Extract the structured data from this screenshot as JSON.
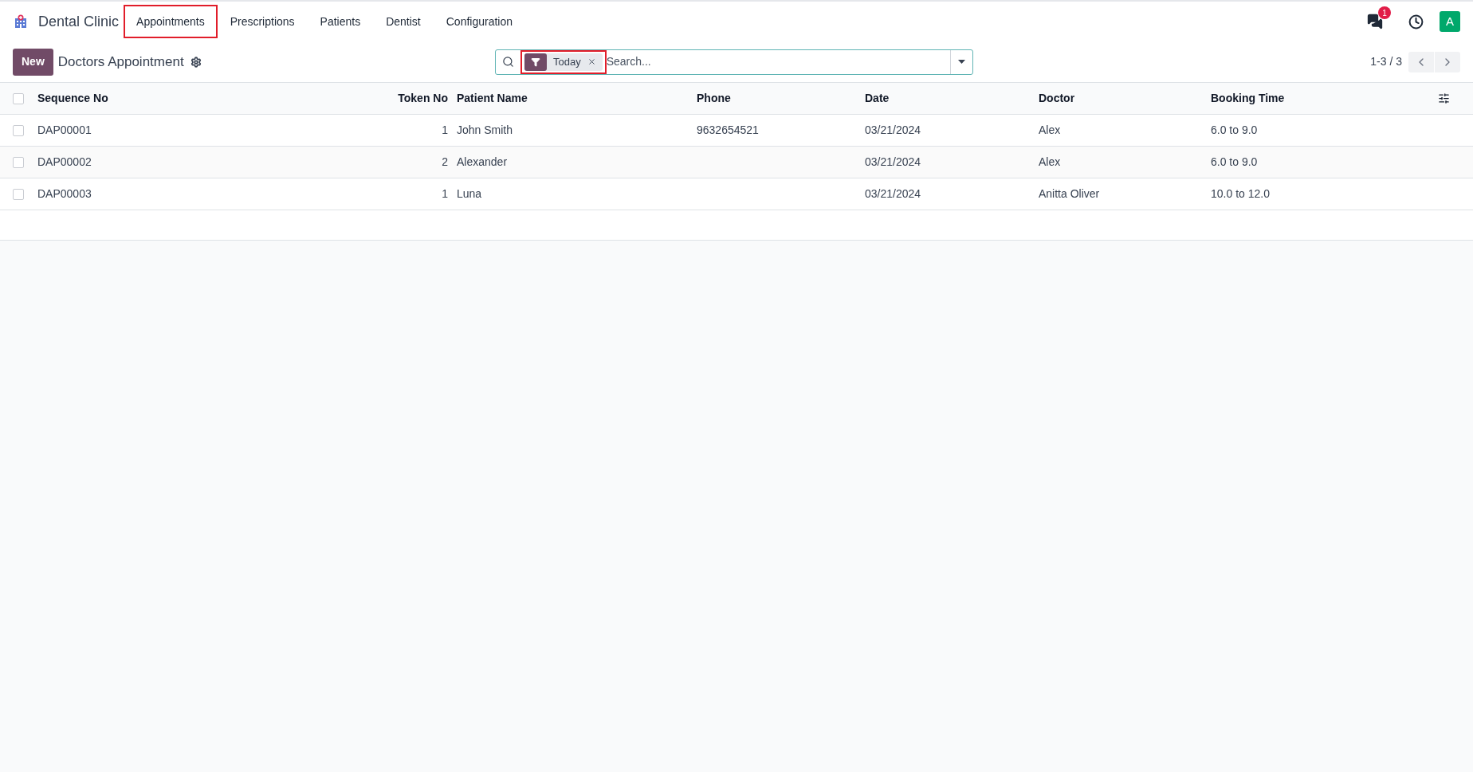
{
  "app": {
    "name": "Dental Clinic"
  },
  "menu": [
    {
      "label": "Appointments",
      "highlighted": true
    },
    {
      "label": "Prescriptions",
      "highlighted": false
    },
    {
      "label": "Patients",
      "highlighted": false
    },
    {
      "label": "Dentist",
      "highlighted": false
    },
    {
      "label": "Configuration",
      "highlighted": false
    }
  ],
  "systray": {
    "message_count": "1",
    "avatar": "A"
  },
  "control_panel": {
    "new_button": "New",
    "title": "Doctors Appointment"
  },
  "search": {
    "facets": [
      {
        "label": "Today",
        "highlighted": true
      }
    ],
    "placeholder": "Search..."
  },
  "pager": {
    "value": "1-3 / 3"
  },
  "table": {
    "select_all": {
      "checked": false
    },
    "columns": [
      {
        "label": "Sequence No",
        "kind": "text"
      },
      {
        "label": "Token No",
        "kind": "number"
      },
      {
        "label": "Patient Name",
        "kind": "text"
      },
      {
        "label": "Phone",
        "kind": "text"
      },
      {
        "label": "Date",
        "kind": "text"
      },
      {
        "label": "Doctor",
        "kind": "text"
      },
      {
        "label": "Booking Time",
        "kind": "text"
      }
    ],
    "rows": [
      {
        "checked": false,
        "cells": [
          "DAP00001",
          "1",
          "John Smith",
          "9632654521",
          "03/21/2024",
          "Alex",
          "6.0 to 9.0"
        ]
      },
      {
        "checked": false,
        "cells": [
          "DAP00002",
          "2",
          "Alexander",
          "",
          "03/21/2024",
          "Alex",
          "6.0 to 9.0"
        ]
      },
      {
        "checked": false,
        "cells": [
          "DAP00003",
          "1",
          "Luna",
          "",
          "03/21/2024",
          "Anitta Oliver",
          "10.0 to 12.0"
        ]
      }
    ]
  }
}
